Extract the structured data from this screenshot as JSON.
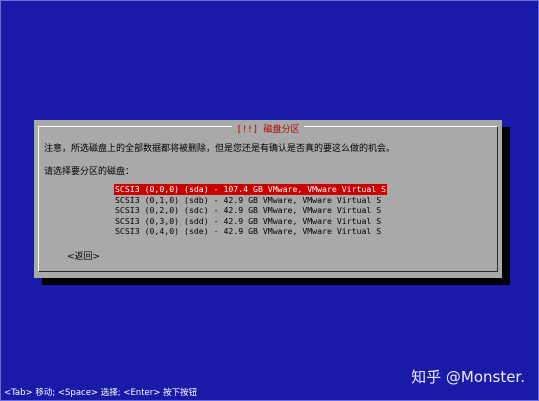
{
  "dialog": {
    "title": "[!!] 磁盘分区",
    "warning": "注意，所选磁盘上的全部数据都将被删除，但是您还是有确认是否真的要这么做的机会。",
    "prompt": "请选择要分区的磁盘：",
    "disks": [
      "SCSI3 (0,0,0) (sda) - 107.4 GB VMware, VMware Virtual S",
      "SCSI3 (0,1,0) (sdb) - 42.9 GB VMware, VMware Virtual S",
      "SCSI3 (0,2,0) (sdc) - 42.9 GB VMware, VMware Virtual S",
      "SCSI3 (0,3,0) (sdd) - 42.9 GB VMware, VMware Virtual S",
      "SCSI3 (0,4,0) (sde) - 42.9 GB VMware, VMware Virtual S"
    ],
    "selected_index": 0,
    "back_label": "<返回>"
  },
  "statusbar": {
    "text": "<Tab> 移动; <Space> 选择; <Enter> 按下按钮"
  },
  "watermark": {
    "text": "知乎 @Monster."
  },
  "colors": {
    "background": "#1a1aa8",
    "dialog": "#a9a9a9",
    "title": "#b00000",
    "selection": "#c80000"
  }
}
